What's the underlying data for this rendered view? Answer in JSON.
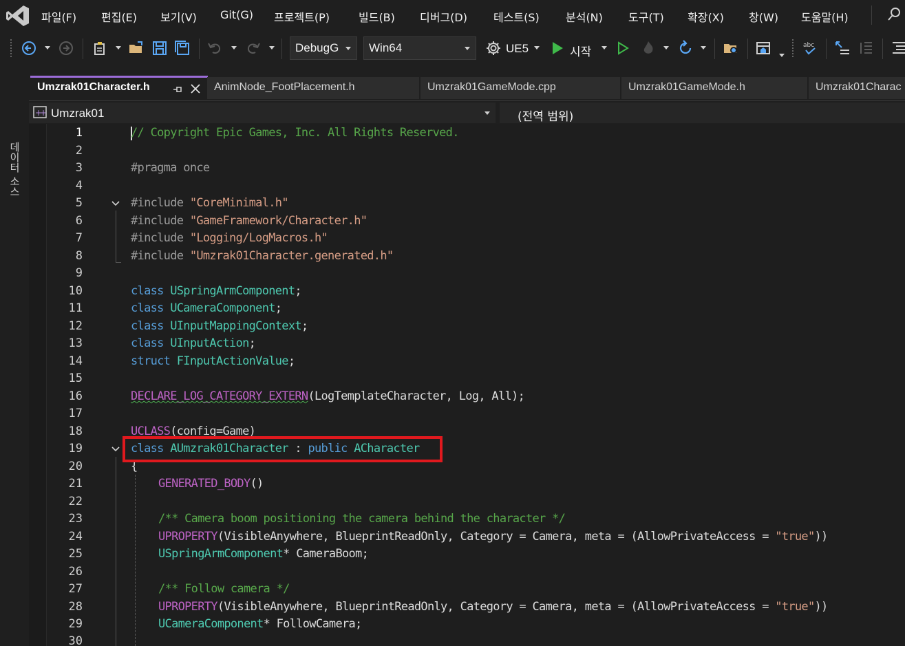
{
  "menu": {
    "items": [
      "파일(F)",
      "편집(E)",
      "보기(V)",
      "Git(G)",
      "프로젝트(P)",
      "빌드(B)",
      "디버그(D)",
      "테스트(S)",
      "분석(N)",
      "도구(T)",
      "확장(X)",
      "창(W)",
      "도움말(H)"
    ]
  },
  "toolbar": {
    "config": "DebugG",
    "platform": "Win64",
    "target": "UE5",
    "start_label": "시작"
  },
  "side_panel": {
    "label": "데이터 소스"
  },
  "tabs": [
    {
      "label": "Umzrak01Character.h",
      "active": true
    },
    {
      "label": "AnimNode_FootPlacement.h",
      "active": false
    },
    {
      "label": "Umzrak01GameMode.cpp",
      "active": false
    },
    {
      "label": "Umzrak01GameMode.h",
      "active": false
    },
    {
      "label": "Umzrak01Charac",
      "active": false
    }
  ],
  "navbar": {
    "project": "Umzrak01",
    "scope": "(전역 범위)"
  },
  "editor": {
    "line_numbers": [
      "1",
      "2",
      "3",
      "4",
      "5",
      "6",
      "7",
      "8",
      "9",
      "10",
      "11",
      "12",
      "13",
      "14",
      "15",
      "16",
      "17",
      "18",
      "19",
      "20",
      "21",
      "22",
      "23",
      "24",
      "25",
      "26",
      "27",
      "28",
      "29",
      "30"
    ],
    "lines": {
      "l1": "// Copyright Epic Games, Inc. All Rights Reserved.",
      "l3": "#pragma once",
      "inc": "#include ",
      "l5s": "\"CoreMinimal.h\"",
      "l6s": "\"GameFramework/Character.h\"",
      "l7s": "\"Logging/LogMacros.h\"",
      "l8s": "\"Umzrak01Character.generated.h\"",
      "class_kw": "class ",
      "struct_kw": "struct ",
      "semi": ";",
      "l10t": "USpringArmComponent",
      "l11t": "UCameraComponent",
      "l12t": "UInputMappingContext",
      "l13t": "UInputAction",
      "l14t": "FInputActionValue",
      "l16m": "DECLARE_LOG_CATEGORY_EXTERN",
      "l16r": "(LogTemplateCharacter, Log, All);",
      "l18m": "UCLASS",
      "l18r": "(config=Game)",
      "l19t": "AUmzrak01Character",
      "l19c": " : ",
      "l19p": "public ",
      "l19b": "ACharacter",
      "l20": "{",
      "l21m": "GENERATED_BODY",
      "l21r": "()",
      "l23": "/** Camera boom positioning the camera behind the character */",
      "up_m": "UPROPERTY",
      "up_r1": "(VisibleAnywhere, BlueprintReadOnly, Category = Camera, meta = (AllowPrivateAccess = ",
      "up_s": "\"true\"",
      "up_r2": "))",
      "l25t": "USpringArmComponent",
      "l25r": "* CameraBoom;",
      "l27": "/** Follow camera */",
      "l29t": "UCameraComponent",
      "l29r": "* FollowCamera;"
    }
  }
}
